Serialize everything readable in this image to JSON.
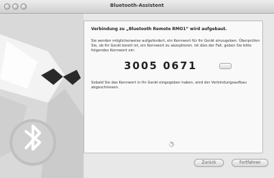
{
  "window": {
    "title": "Bluetooth-Assistent"
  },
  "content": {
    "heading": "Verbindung zu „Bluetooth Remote RMO1“ wird aufgebaut.",
    "paragraph1": "Sie werden möglicherweise aufgefordert, ein Kennwort für Ihr Gerät einzugeben. Überprüfen Sie, ob Ihr Gerät bereit ist, ein Kennwort zu akzeptieren. Ist dies der Fall, geben Sie bitte folgendes Kennwort ein:",
    "passkey": "3005 0671",
    "paragraph2": "Sobald Sie das Kennwort in Ihr Gerät eingegeben haben, wird der Verbindungsaufbau abgeschlossen."
  },
  "buttons": {
    "back": "Zurück",
    "continue": "Fortfahren"
  },
  "icons": {
    "traffic_lights": "traffic-light-icon",
    "sidebar": "bluetooth-icon",
    "spinner": "spinner-icon",
    "help": "help-icon"
  }
}
